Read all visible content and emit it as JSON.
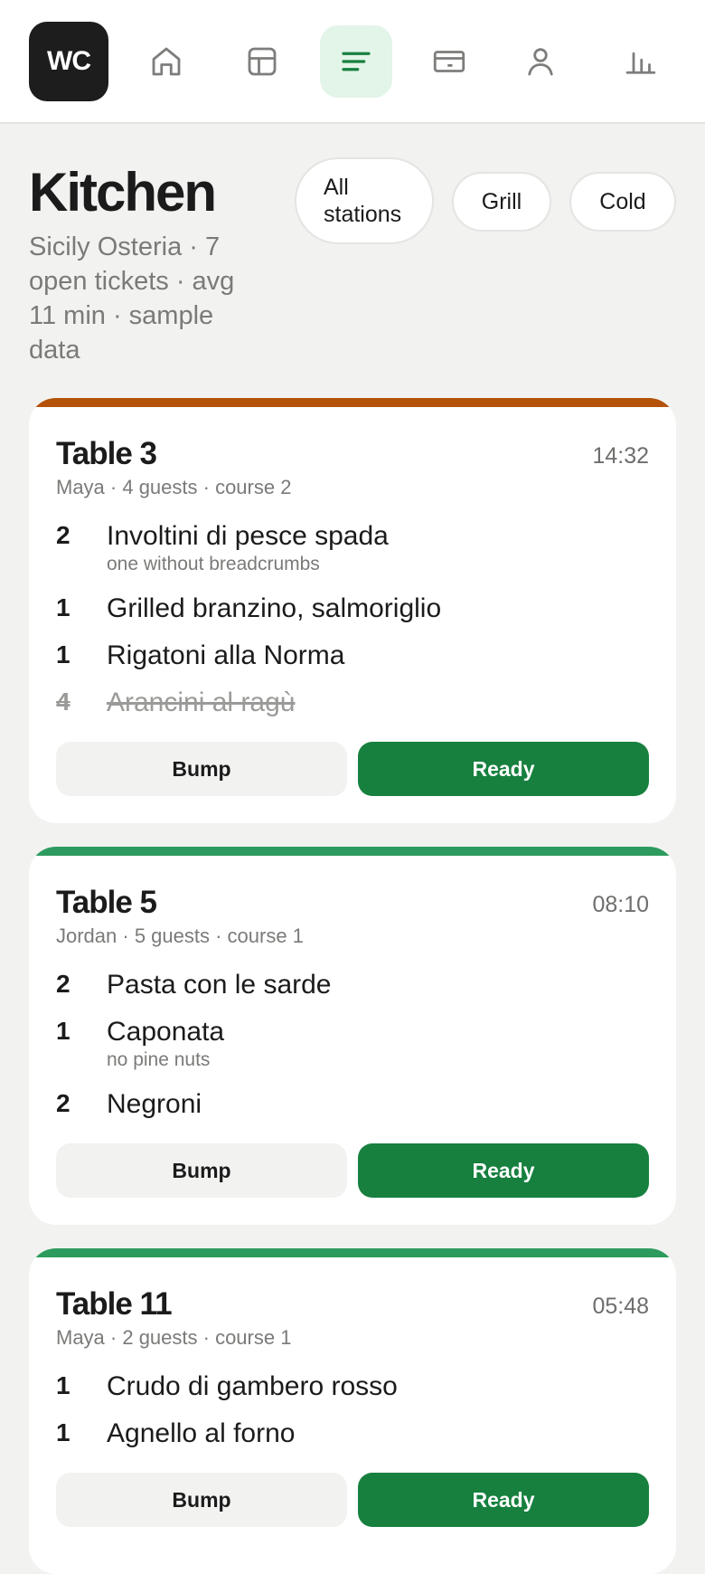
{
  "app": {
    "logo_text": "WC"
  },
  "nav": {
    "items": [
      {
        "name": "home",
        "icon": "home-icon"
      },
      {
        "name": "tables",
        "icon": "table-layout-icon"
      },
      {
        "name": "kitchen",
        "icon": "list-icon",
        "active": true
      },
      {
        "name": "payments",
        "icon": "card-icon"
      },
      {
        "name": "staff",
        "icon": "person-icon"
      },
      {
        "name": "reports",
        "icon": "bar-chart-icon"
      }
    ]
  },
  "header": {
    "title": "Kitchen",
    "subtitle": "Sicily Osteria · 7 open tickets · avg 11 min · sample data"
  },
  "filters": [
    {
      "label": "All stations",
      "selected": true
    },
    {
      "label": "Grill"
    },
    {
      "label": "Cold"
    }
  ],
  "tickets": [
    {
      "title": "Table 3",
      "time": "14:32",
      "meta": "Maya · 4 guests · course 2",
      "accent": "#b4520a",
      "items": [
        {
          "qty": "2",
          "name": "Involtini di pesce spada",
          "note": "one without breadcrumbs"
        },
        {
          "qty": "1",
          "name": "Grilled branzino, salmoriglio"
        },
        {
          "qty": "1",
          "name": "Rigatoni alla Norma"
        },
        {
          "qty": "4",
          "name": "Arancini al ragù",
          "done": true
        }
      ],
      "bump_label": "Bump",
      "ready_label": "Ready"
    },
    {
      "title": "Table 5",
      "time": "08:10",
      "meta": "Jordan · 5 guests · course 1",
      "accent": "#2e9b5e",
      "items": [
        {
          "qty": "2",
          "name": "Pasta con le sarde"
        },
        {
          "qty": "1",
          "name": "Caponata",
          "note": "no pine nuts"
        },
        {
          "qty": "2",
          "name": "Negroni"
        }
      ],
      "bump_label": "Bump",
      "ready_label": "Ready"
    },
    {
      "title": "Table 11",
      "time": "05:48",
      "meta": "Maya · 2 guests · course 1",
      "accent": "#2e9b5e",
      "items": [
        {
          "qty": "1",
          "name": "Crudo di gambero rosso"
        },
        {
          "qty": "1",
          "name": "Agnello al forno"
        }
      ],
      "bump_label": "Bump",
      "ready_label": "Ready"
    }
  ],
  "colors": {
    "brand_green": "#17803f",
    "active_nav_bg": "#e3f4e8",
    "late_accent": "#b4520a",
    "ok_accent": "#2e9b5e"
  }
}
